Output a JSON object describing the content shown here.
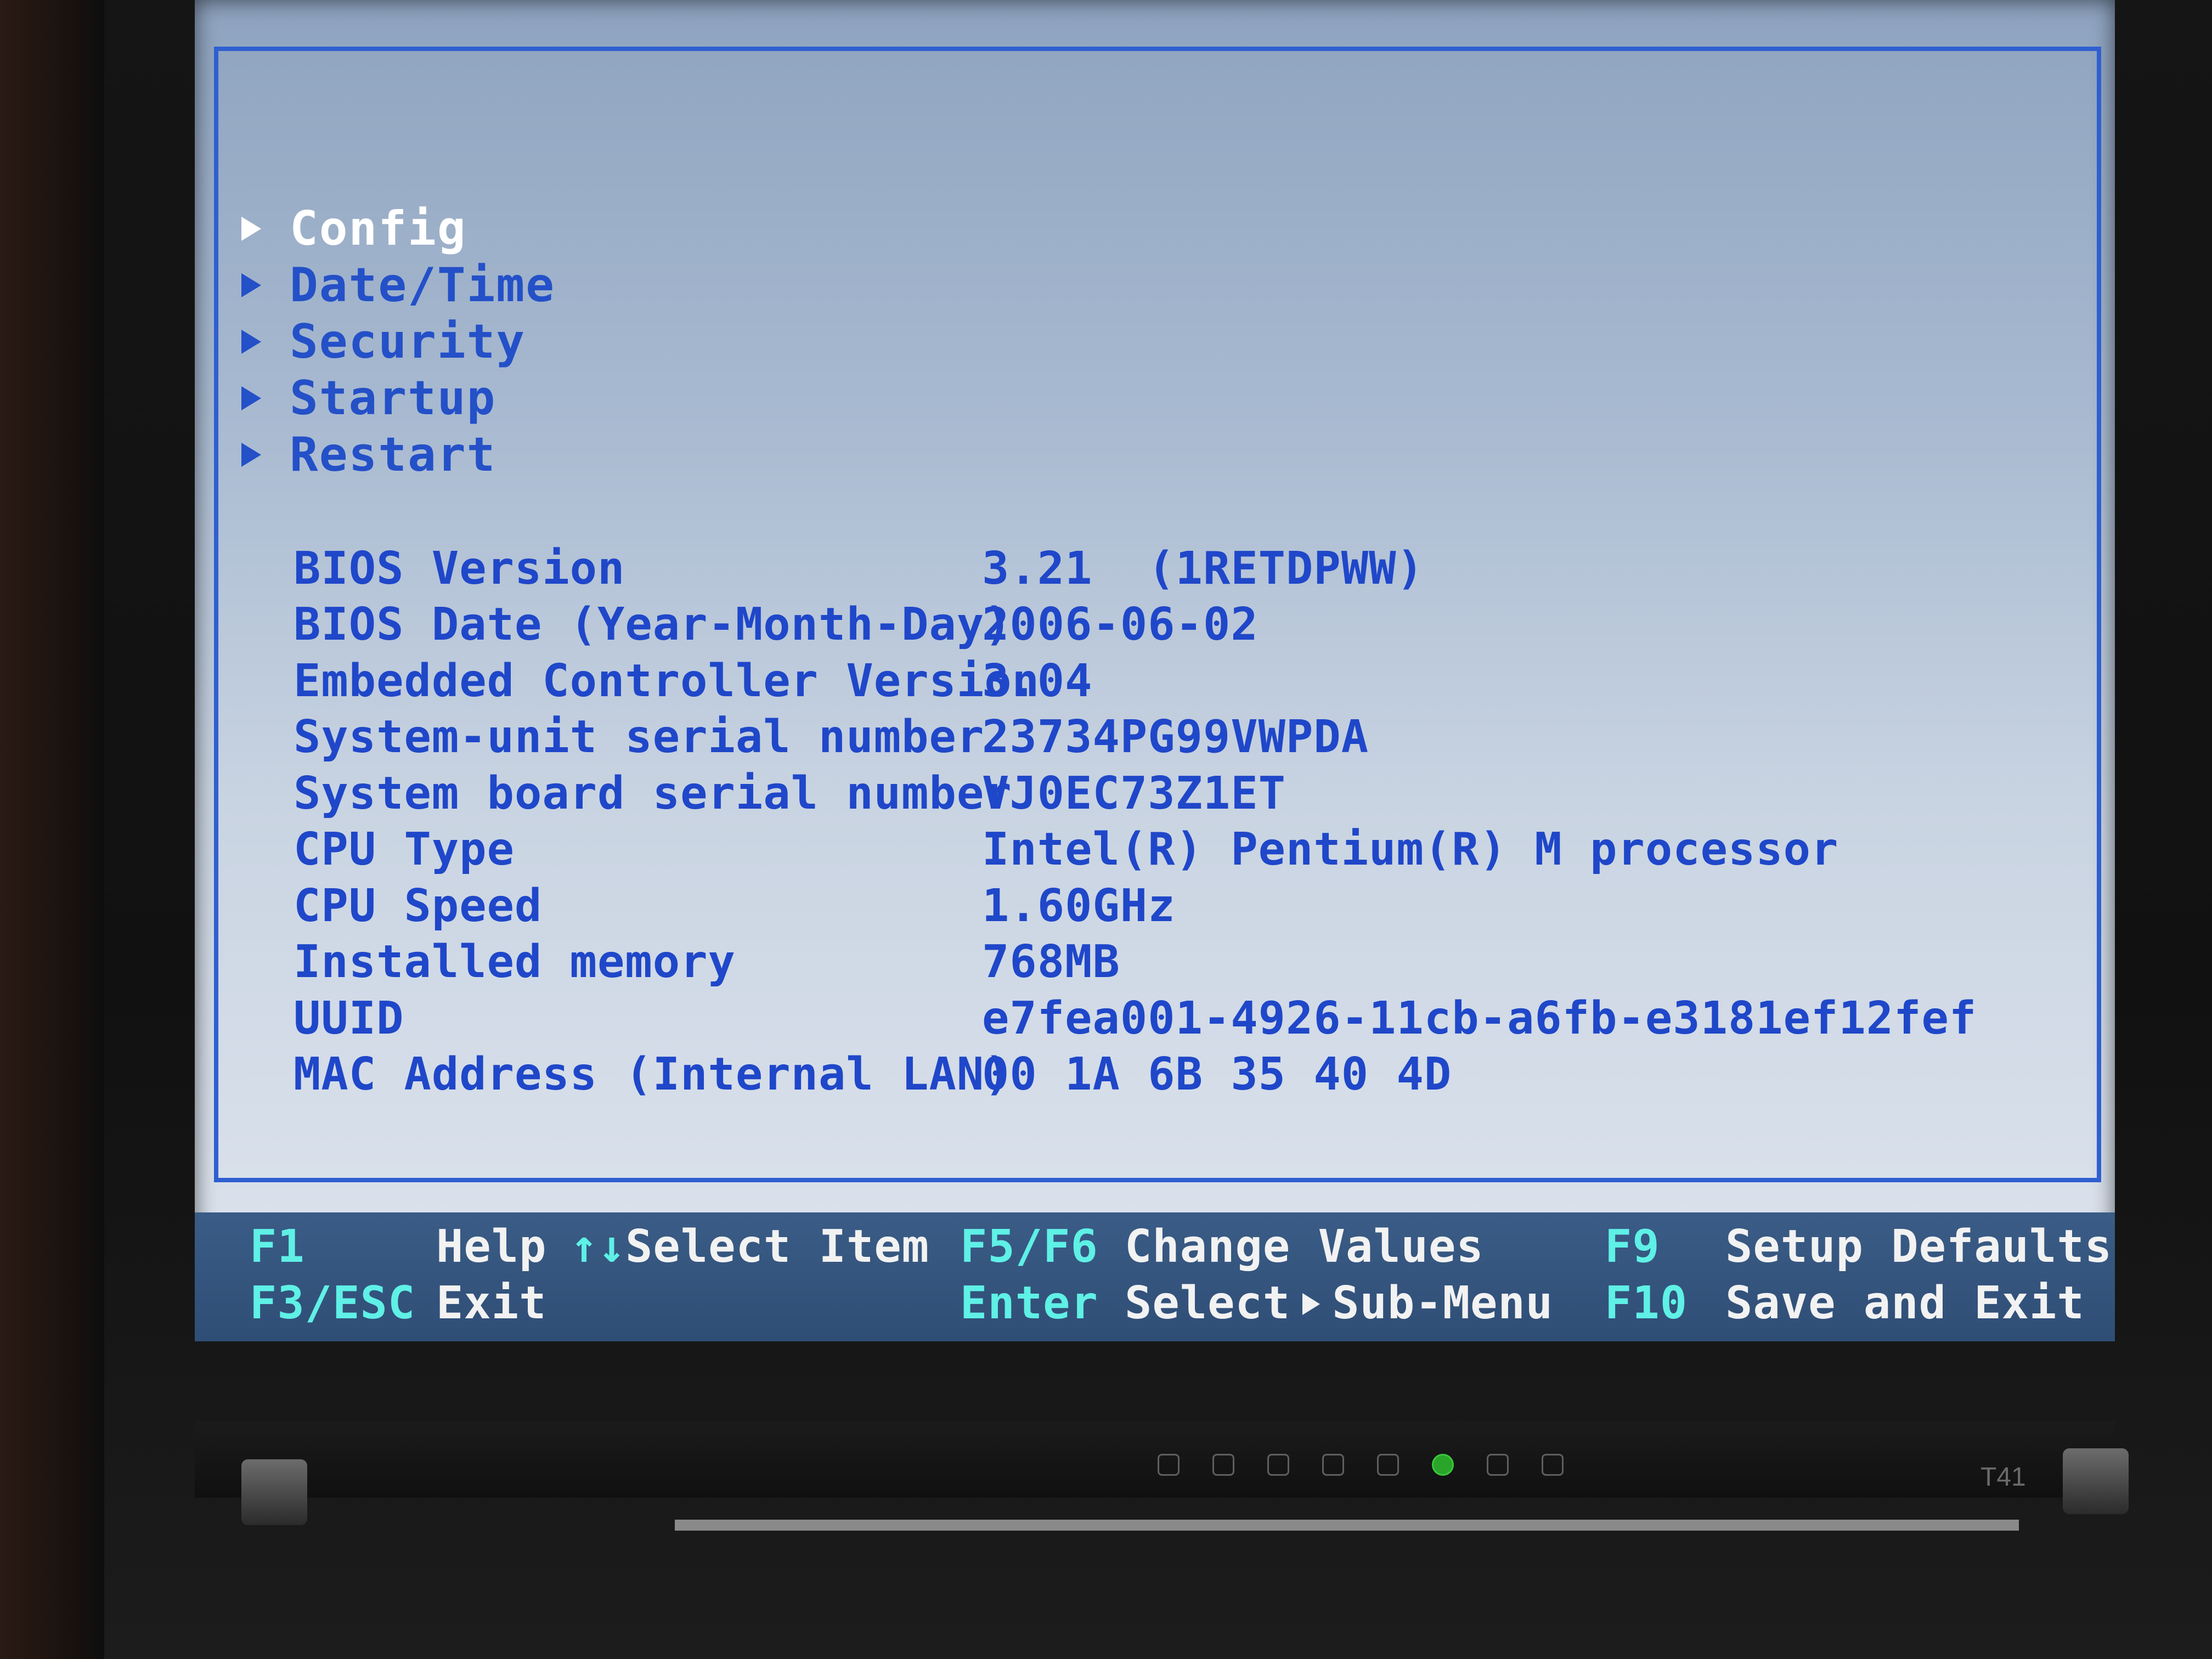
{
  "menu": {
    "items": [
      {
        "label": "Config",
        "selected": true
      },
      {
        "label": "Date/Time",
        "selected": false
      },
      {
        "label": "Security",
        "selected": false
      },
      {
        "label": "Startup",
        "selected": false
      },
      {
        "label": "Restart",
        "selected": false
      }
    ]
  },
  "info": {
    "rows": [
      {
        "label": "BIOS Version",
        "value": "3.21  (1RETDPWW)"
      },
      {
        "label": "BIOS Date (Year-Month-Day)",
        "value": "2006-06-02"
      },
      {
        "label": "Embedded Controller Version",
        "value": "3.04"
      },
      {
        "label": "System-unit serial number",
        "value": "23734PG99VWPDA"
      },
      {
        "label": "System board serial number",
        "value": "VJ0EC73Z1ET"
      },
      {
        "label": "CPU Type",
        "value": "Intel(R) Pentium(R) M processor"
      },
      {
        "label": "CPU Speed",
        "value": "1.60GHz"
      },
      {
        "label": "Installed memory",
        "value": "768MB"
      },
      {
        "label": "UUID",
        "value": "e7fea001-4926-11cb-a6fb-e3181ef12fef"
      },
      {
        "label": "MAC Address (Internal LAN)",
        "value": "00 1A 6B 35 40 4D"
      }
    ]
  },
  "footer": {
    "f1_key": "F1",
    "f1_desc": "Help",
    "arrows_key": "↑↓",
    "arrows_desc": "Select Item",
    "f5f6_key": "F5/F6",
    "f5f6_desc": "Change Values",
    "f9_key": "F9",
    "f9_desc": "Setup Defaults",
    "esc_key": "F3/ESC",
    "esc_desc": "Exit",
    "enter_key": "Enter",
    "enter_desc_a": "Select",
    "enter_desc_b": "Sub-Menu",
    "f10_key": "F10",
    "f10_desc": "Save and Exit"
  },
  "laptop": {
    "model": "T41"
  },
  "colors": {
    "screen_bg": "#c9d4e2",
    "text_blue": "#1f47c9",
    "selected_white": "#ffffff",
    "footer_bg": "#34557f",
    "footer_key": "#5ff0e6"
  }
}
